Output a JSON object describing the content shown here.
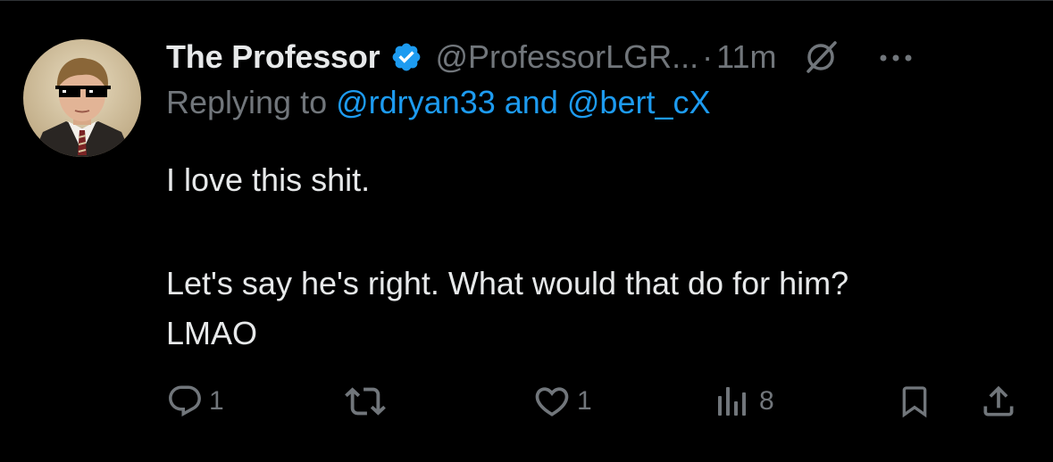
{
  "tweet": {
    "display_name": "The Professor",
    "handle": "@ProfessorLGR...",
    "separator": "·",
    "time": "11m",
    "replying_prefix": "Replying to",
    "reply_to_1": "@rdryan33",
    "reply_and": "and",
    "reply_to_2": "@bert_cX",
    "text_line_1": "I love this shit.",
    "text_line_2": "Let's say he's right. What would that do for him?",
    "text_line_3": "LMAO"
  },
  "actions": {
    "replies": "1",
    "retweets": "",
    "likes": "1",
    "views": "8"
  },
  "colors": {
    "background": "#000000",
    "text": "#e7e9ea",
    "muted": "#71767b",
    "accent": "#1d9bf0",
    "divider": "#2f3336"
  },
  "icons": [
    "verified-badge-icon",
    "grok-icon",
    "more-icon",
    "reply-icon",
    "retweet-icon",
    "like-icon",
    "views-icon",
    "bookmark-icon",
    "share-icon"
  ]
}
